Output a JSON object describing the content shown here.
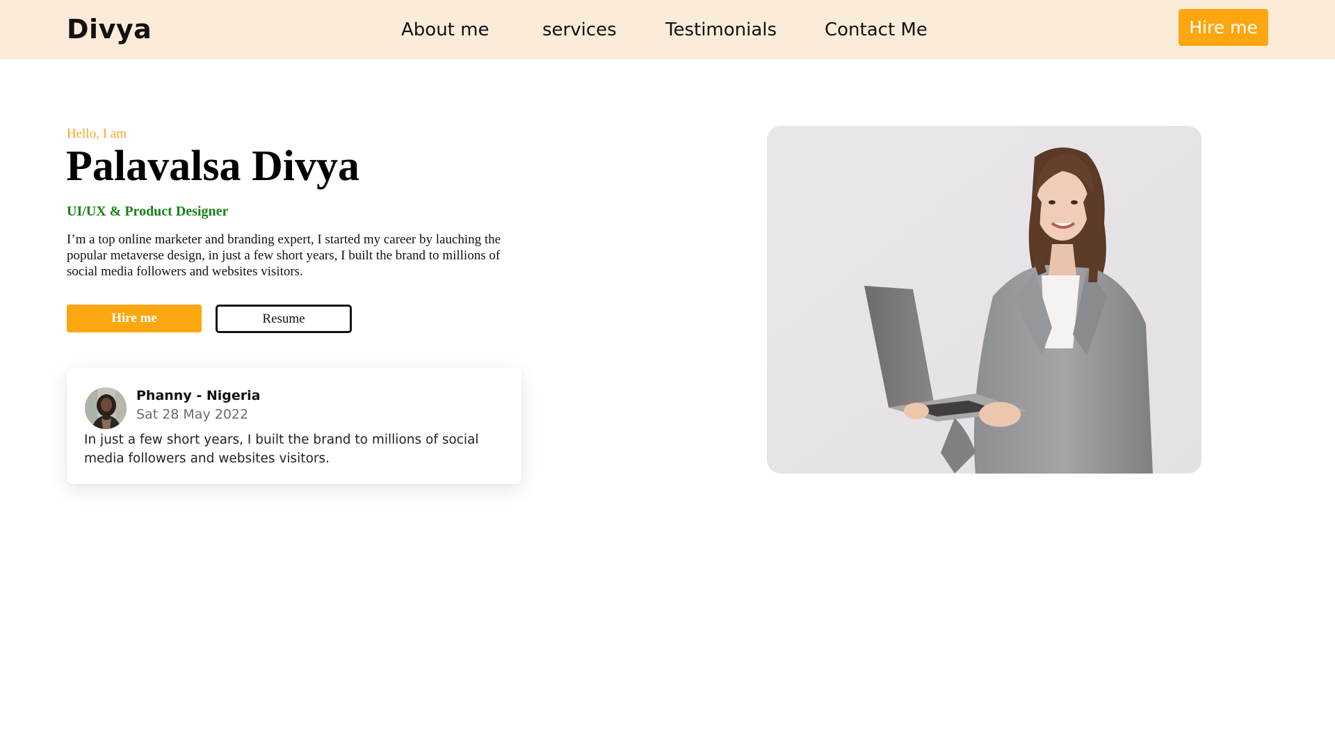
{
  "nav": {
    "brand": "Divya",
    "links": [
      {
        "label": "About me"
      },
      {
        "label": "services"
      },
      {
        "label": "Testimonials"
      },
      {
        "label": "Contact Me"
      }
    ],
    "hire_label": "Hire me"
  },
  "hero": {
    "greeting": "Hello, I am",
    "name": "Palavalsa Divya",
    "role": "UI/UX & Product Designer",
    "bio": "I’m a top online marketer and branding expert, I started my career by lauching the popular metaverse design, in just a few short years, I built the brand to millions of social media followers and websites visitors.",
    "hire_label": "Hire me",
    "resume_label": "Resume"
  },
  "testimonial": {
    "name": "Phanny - Nigeria",
    "date": "Sat 28 May 2022",
    "text": "In just a few short years, I built the brand to millions of social media followers and websites visitors."
  },
  "colors": {
    "nav_bg": "#fbecd9",
    "accent": "#fca710",
    "greeting": "#f6a623",
    "role": "#198119"
  }
}
